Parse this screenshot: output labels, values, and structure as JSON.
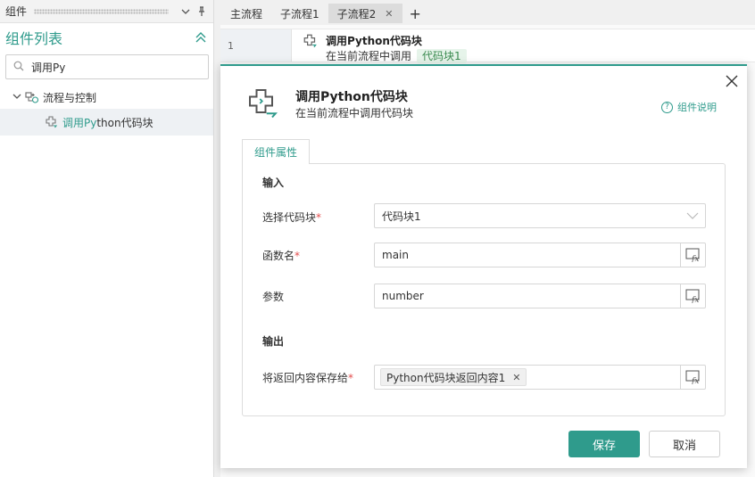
{
  "left_panel": {
    "header_title": "组件",
    "list_title": "组件列表",
    "search_value": "调用Py",
    "tree": {
      "group_label": "流程与控制",
      "item_label_highlight": "调用Py",
      "item_label_rest": "thon代码块"
    }
  },
  "tabs": [
    {
      "label": "主流程"
    },
    {
      "label": "子流程1"
    },
    {
      "label": "子流程2"
    }
  ],
  "flow_row": {
    "line_number": "1",
    "title": "调用Python代码块",
    "subtitle": "在当前流程中调用",
    "badge": "代码块1"
  },
  "dialog": {
    "title": "调用Python代码块",
    "subtitle": "在当前流程中调用代码块",
    "help_label": "组件说明",
    "props_tab": "组件属性",
    "input_section": "输入",
    "output_section": "输出",
    "fields": {
      "code_block": {
        "label": "选择代码块",
        "required": "*",
        "value": "代码块1"
      },
      "function_name": {
        "label": "函数名",
        "required": "*",
        "value": "main"
      },
      "params": {
        "label": "参数",
        "value": "number"
      },
      "save_to": {
        "label": "将返回内容保存给",
        "required": "*",
        "chip": "Python代码块返回内容1"
      }
    },
    "save_label": "保存",
    "cancel_label": "取消"
  },
  "colors": {
    "accent": "#2f9b8c",
    "required": "#e34d4d",
    "badge_bg": "#e6f4ea",
    "badge_text": "#3a8a4f"
  },
  "icons": [
    "search-icon",
    "chevron-down-icon",
    "pin-icon",
    "collapse-up-icon",
    "tree-expand-icon",
    "flow-control-icon",
    "python-block-icon",
    "close-icon",
    "help-icon",
    "fx-icon",
    "plus-icon"
  ]
}
